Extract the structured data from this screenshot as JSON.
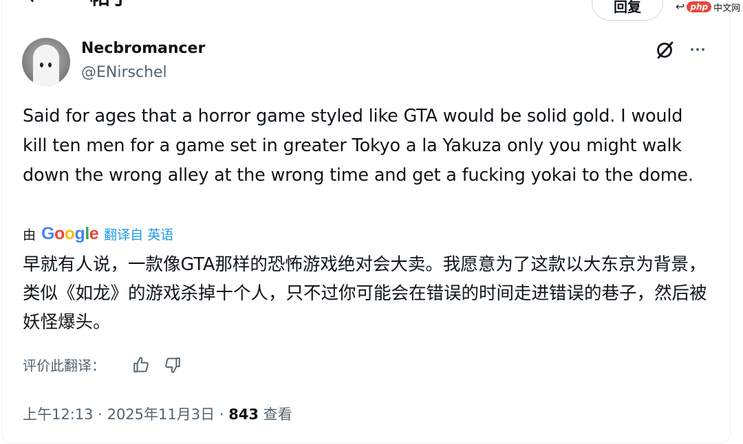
{
  "header": {
    "back_icon": "←",
    "title": "帖子",
    "reply_label": "回复"
  },
  "watermark": {
    "logo": "php",
    "text": "中文网"
  },
  "author": {
    "name": "Necbromancer",
    "handle": "@ENirschel"
  },
  "tweet": {
    "text": "Said for ages that a horror game styled like GTA would be solid gold. I would kill ten men for a game set in greater Tokyo a la Yakuza only you might walk down the wrong alley at the wrong time and get a fucking yokai to the dome."
  },
  "translation": {
    "by_label": "由",
    "provider": "Google",
    "link_label": "翻译自 英语",
    "text": "早就有人说，一款像GTA那样的恐怖游戏绝对会大卖。我愿意为了这款以大东京为背景，类似《如龙》的游戏杀掉十个人，只不过你可能会在错误的时间走进错误的巷子，然后被妖怪爆头。",
    "rate_label": "评价此翻译："
  },
  "meta": {
    "time": "上午12:13",
    "date": "2025年11月3日",
    "separator": "·",
    "views_count": "843",
    "views_label": "查看"
  },
  "icons": {
    "back": "arrow-left-icon",
    "grok": "grok-icon",
    "more": "more-horizontal-icon",
    "thumb_up": "thumbs-up-icon",
    "thumb_down": "thumbs-down-icon"
  },
  "colors": {
    "accent": "#1d9bf0",
    "text_primary": "#0f1419",
    "text_secondary": "#536471",
    "google_blue": "#4285F4",
    "google_red": "#EA4335",
    "google_yellow": "#FBBC05",
    "google_green": "#34A853"
  }
}
